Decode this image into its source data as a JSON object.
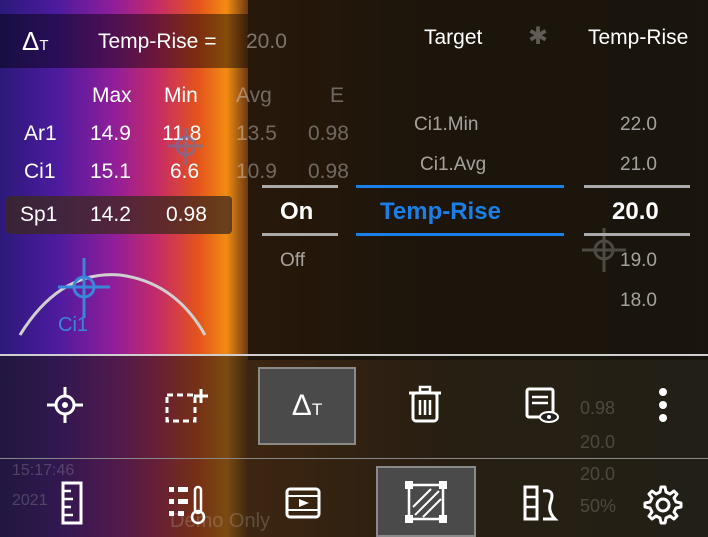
{
  "header": {
    "delta_label": "Δ",
    "delta_sub": "T",
    "temp_rise_label": "Temp-Rise =",
    "temp_rise_value": "20.0",
    "target_label": "Target",
    "target_value": "Temp-Rise"
  },
  "readout": {
    "columns": [
      "Max",
      "Min",
      "Avg",
      "E"
    ],
    "rows": [
      {
        "name": "Ar1",
        "max": "14.9",
        "min": "11.8",
        "avg": "13.5",
        "e": "0.98"
      },
      {
        "name": "Ci1",
        "max": "15.1",
        "min": "6.6",
        "avg": "10.9",
        "e": "0.98"
      },
      {
        "name": "Sp1",
        "max": "14.2",
        "min": "0.98",
        "avg": "",
        "e": ""
      }
    ]
  },
  "spot_label": "Ci1",
  "picker": {
    "state": {
      "selected": "On",
      "below": "Off"
    },
    "target": {
      "above2": "Ci1.Min",
      "above1": "Ci1.Avg",
      "selected": "Temp-Rise"
    },
    "value": {
      "above2": "22.0",
      "above1": "21.0",
      "selected": "20.0",
      "below1": "19.0",
      "below2": "18.0"
    }
  },
  "toolbar": {
    "row1": [
      "spot-tool",
      "area-tool",
      "delta-t-tool",
      "delete-tool",
      "report-tool",
      "more-tool"
    ],
    "delta_label": "Δ",
    "delta_sub": "T"
  },
  "status": {
    "time": "15:17:46",
    "date": "2021",
    "mode": "Demo Only",
    "emissivity": "0.98",
    "reflected": "20.0",
    "ambient": "20.0",
    "humidity": "50%"
  },
  "colors": {
    "accent": "#1a7fe8",
    "active_tool": "#4a4a4a"
  }
}
